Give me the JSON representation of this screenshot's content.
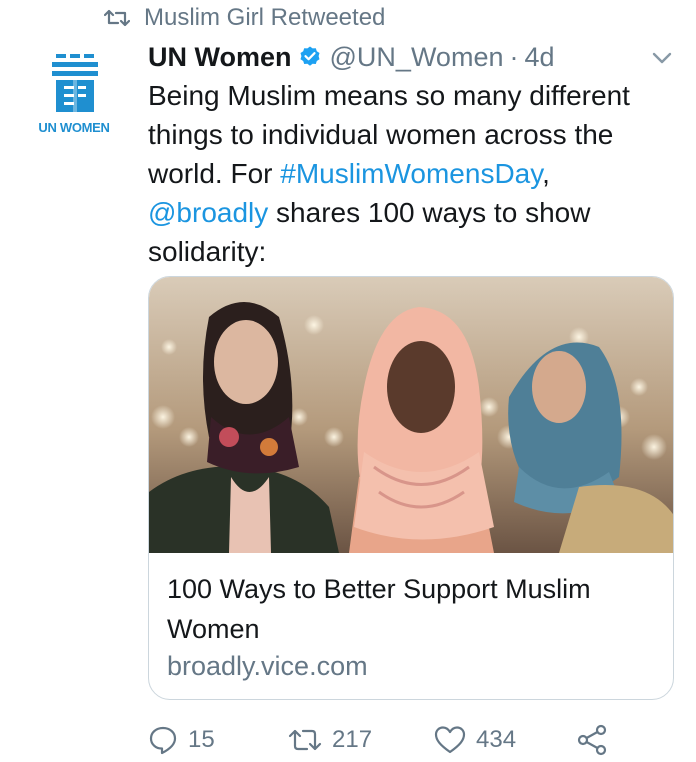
{
  "retweet_context": {
    "text": "Muslim Girl Retweeted",
    "icon": "retweet-icon"
  },
  "author": {
    "display_name": "UN Women",
    "handle": "@UN_Women",
    "separator": "·",
    "time": "4d",
    "verified": true,
    "avatar_label": "UN WOMEN",
    "avatar_icon": "un-women-logo"
  },
  "tweet": {
    "text_parts": [
      "Being Muslim means so many different things to individual women across the world. For ",
      "#MuslimWomensDay",
      ", ",
      "@broadly",
      " shares 100 ways to show solidarity:"
    ]
  },
  "card": {
    "title": "100 Ways to Better Support Muslim Women",
    "domain": "broadly.vice.com",
    "image_icon": "three-women-headscarves-photo"
  },
  "actions": {
    "reply_count": "15",
    "retweet_count": "217",
    "like_count": "434"
  },
  "colors": {
    "link": "#1b95e0",
    "secondary_text": "#657786",
    "verified": "#1da1f2",
    "un_blue": "#1f8fd0"
  }
}
